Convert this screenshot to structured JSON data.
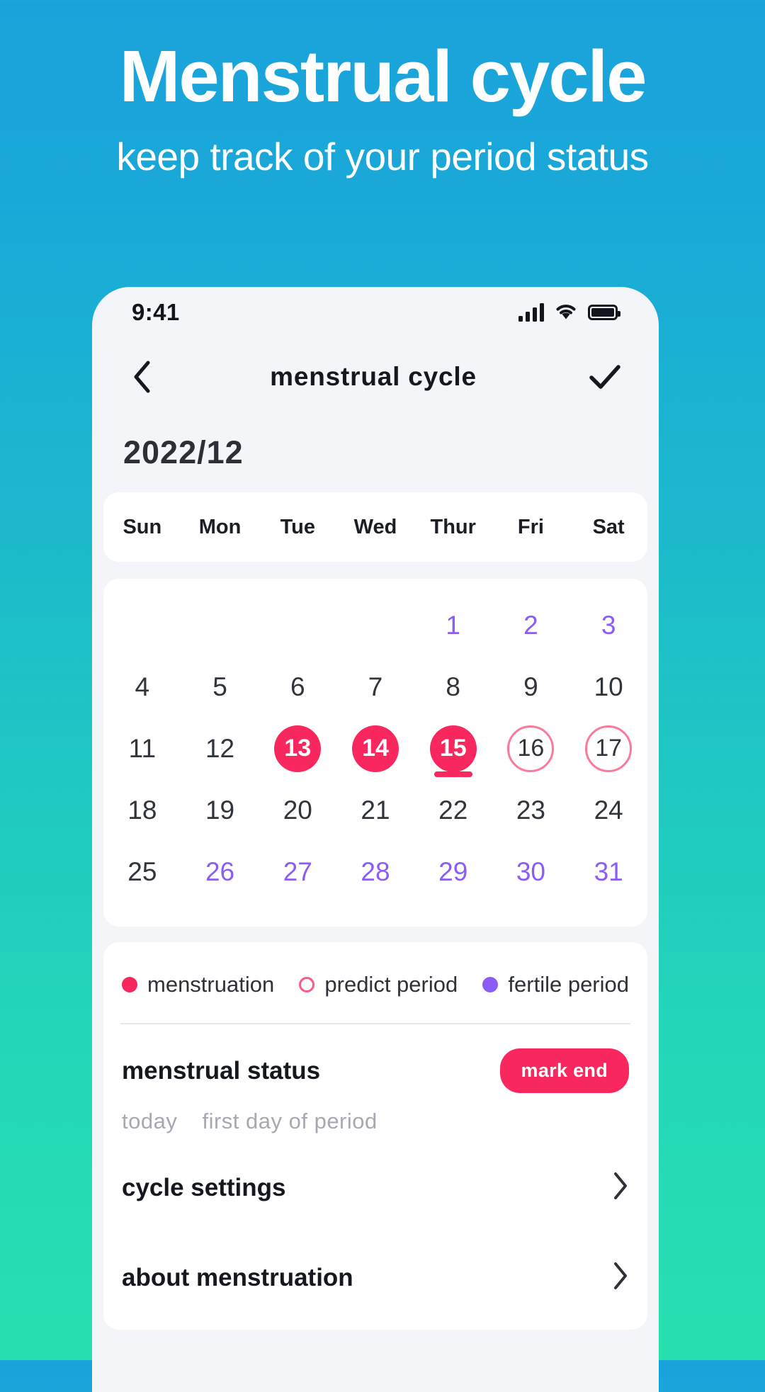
{
  "promo": {
    "title": "Menstrual cycle",
    "subtitle": "keep track of your period status"
  },
  "colors": {
    "accent_pink": "#f8285f",
    "ring_pink": "#fb7a9c",
    "violet": "#8b5cf6",
    "bg_top": "#1aa3db",
    "bg_bottom": "#27e0b0"
  },
  "phone": {
    "status_bar": {
      "time": "9:41",
      "icons": [
        "signal-bars-icon",
        "wifi-icon",
        "battery-icon"
      ]
    },
    "nav": {
      "back_icon": "chevron-left-icon",
      "title": "menstrual cycle",
      "confirm_icon": "check-icon"
    },
    "month_label": "2022/12",
    "weekdays": [
      "Sun",
      "Mon",
      "Tue",
      "Wed",
      "Thur",
      "Fri",
      "Sat"
    ],
    "calendar": {
      "cells": [
        {
          "label": "",
          "style": "empty"
        },
        {
          "label": "",
          "style": "empty"
        },
        {
          "label": "",
          "style": "empty"
        },
        {
          "label": "",
          "style": "empty"
        },
        {
          "label": "1",
          "style": "violet"
        },
        {
          "label": "2",
          "style": "violet"
        },
        {
          "label": "3",
          "style": "violet"
        },
        {
          "label": "4",
          "style": "normal"
        },
        {
          "label": "5",
          "style": "normal"
        },
        {
          "label": "6",
          "style": "normal"
        },
        {
          "label": "7",
          "style": "normal"
        },
        {
          "label": "8",
          "style": "normal"
        },
        {
          "label": "9",
          "style": "normal"
        },
        {
          "label": "10",
          "style": "normal"
        },
        {
          "label": "11",
          "style": "normal"
        },
        {
          "label": "12",
          "style": "normal"
        },
        {
          "label": "13",
          "style": "filled"
        },
        {
          "label": "14",
          "style": "filled"
        },
        {
          "label": "15",
          "style": "filled-today"
        },
        {
          "label": "16",
          "style": "ring"
        },
        {
          "label": "17",
          "style": "ring"
        },
        {
          "label": "18",
          "style": "normal"
        },
        {
          "label": "19",
          "style": "normal"
        },
        {
          "label": "20",
          "style": "normal"
        },
        {
          "label": "21",
          "style": "normal"
        },
        {
          "label": "22",
          "style": "normal"
        },
        {
          "label": "23",
          "style": "normal"
        },
        {
          "label": "24",
          "style": "normal"
        },
        {
          "label": "25",
          "style": "normal"
        },
        {
          "label": "26",
          "style": "violet"
        },
        {
          "label": "27",
          "style": "violet"
        },
        {
          "label": "28",
          "style": "violet"
        },
        {
          "label": "29",
          "style": "violet"
        },
        {
          "label": "30",
          "style": "violet"
        },
        {
          "label": "31",
          "style": "violet"
        }
      ]
    },
    "legend": [
      {
        "marker": "filled-pink-dot",
        "label": "menstruation"
      },
      {
        "marker": "ring-pink-dot",
        "label": "predict period"
      },
      {
        "marker": "filled-violet-dot",
        "label": "fertile period"
      }
    ],
    "status": {
      "title": "menstrual status",
      "button_label": "mark end",
      "sub_left": "today",
      "sub_right": "first day of period"
    },
    "list": [
      {
        "label": "cycle settings",
        "chevron": "chevron-right-icon"
      },
      {
        "label": "about menstruation",
        "chevron": "chevron-right-icon"
      }
    ]
  }
}
